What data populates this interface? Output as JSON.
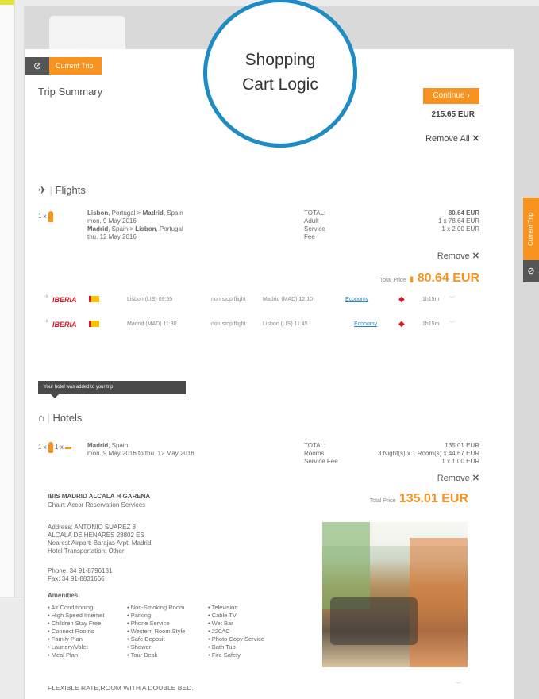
{
  "current_trip_label": "Current Trip",
  "trip_summary": "Trip Summary",
  "overlay_circle": {
    "line1": "Shopping",
    "line2": "Cart Logic"
  },
  "continue_label": "Continue",
  "total_eur": "215.65 EUR",
  "remove_all": "Remove All",
  "side_tab_label": "Current Trip",
  "flights": {
    "title": "Flights",
    "qty": "1 x",
    "route1": {
      "from": "Lisbon",
      "from_country": ", Portugal > ",
      "to": "Madrid",
      "to_country": ", Spain",
      "date": "mon. 9 May 2016"
    },
    "route2": {
      "from": "Madrid",
      "from_country": ", Spain > ",
      "to": "Lisbon",
      "to_country": ", Portugal",
      "date": "thu. 12 May 2016"
    },
    "total_labels": [
      "TOTAL:",
      "Adult",
      "Service",
      "Fee"
    ],
    "total_values": [
      "80.64 EUR",
      "1 x 78.64 EUR",
      "1 x 2.00 EUR"
    ],
    "remove": "Remove",
    "total_price_label": "Total Price",
    "total_price": "80.64 EUR",
    "segments": [
      {
        "airline": "IBERIA",
        "depart": "Lisbon (LIS) 09:55",
        "type": "non stop flight",
        "arrive": "Madrid (MAD) 12:10",
        "class": "Economy",
        "duration": "1h15m"
      },
      {
        "airline": "IBERIA",
        "depart": "Madrid (MAD) 11:30",
        "type": "non stop flight",
        "arrive": "Lisbon (LIS) 11:45",
        "class": "Economy",
        "duration": "1h15m"
      }
    ]
  },
  "tooltip": "Your hotel was added to your trip",
  "hotels": {
    "title": "Hotels",
    "qty": "1 x",
    "qty2": "1 x",
    "city": "Madrid",
    "country": ", Spain",
    "dates": "mon. 9 May 2016 to thu. 12 May 2016",
    "total_labels": [
      "TOTAL:",
      "Rooms",
      "Service Fee"
    ],
    "total_values": [
      "135.01 EUR",
      "3 Night(s) x 1 Room(s) x  44.67 EUR",
      "1 x 1.00 EUR"
    ],
    "remove": "Remove",
    "name": "IBIS MADRID ALCALA H GARENA",
    "chain": "Chain: Accor Reservation Services",
    "total_price_label": "Total Price",
    "total_price": "135.01 EUR",
    "address": [
      "Address: ANTONIO SUAREZ 8",
      "ALCALA DE HENARES 28802 ES",
      "Nearest Airport: Barajas Arpt, Madrid",
      "Hotel Transportation: Other"
    ],
    "phone": "Phone: 34 91-8796181",
    "fax": "Fax: 34 91-8831666",
    "amenities_title": "Amenities",
    "amenities_col1": [
      "Air Conditioning",
      "High Speed Internet",
      "Children Stay Free",
      "Connect Rooms",
      "Family Plan",
      "Laundry/Valet",
      "Meal Plan"
    ],
    "amenities_col2": [
      "Non-Smoking Room",
      "Parking",
      "Phone Service",
      "Western Room Style",
      "Safe Deposit",
      "Shower",
      "Tour Desk"
    ],
    "amenities_col3": [
      "Television",
      "Cable TV",
      "Wet Bar",
      "220AC",
      "Photo Copy Service",
      "Bath Tub",
      "Fire Safety"
    ],
    "rate": "FLEXIBLE RATE,ROOM WITH A DOUBLE BED."
  }
}
